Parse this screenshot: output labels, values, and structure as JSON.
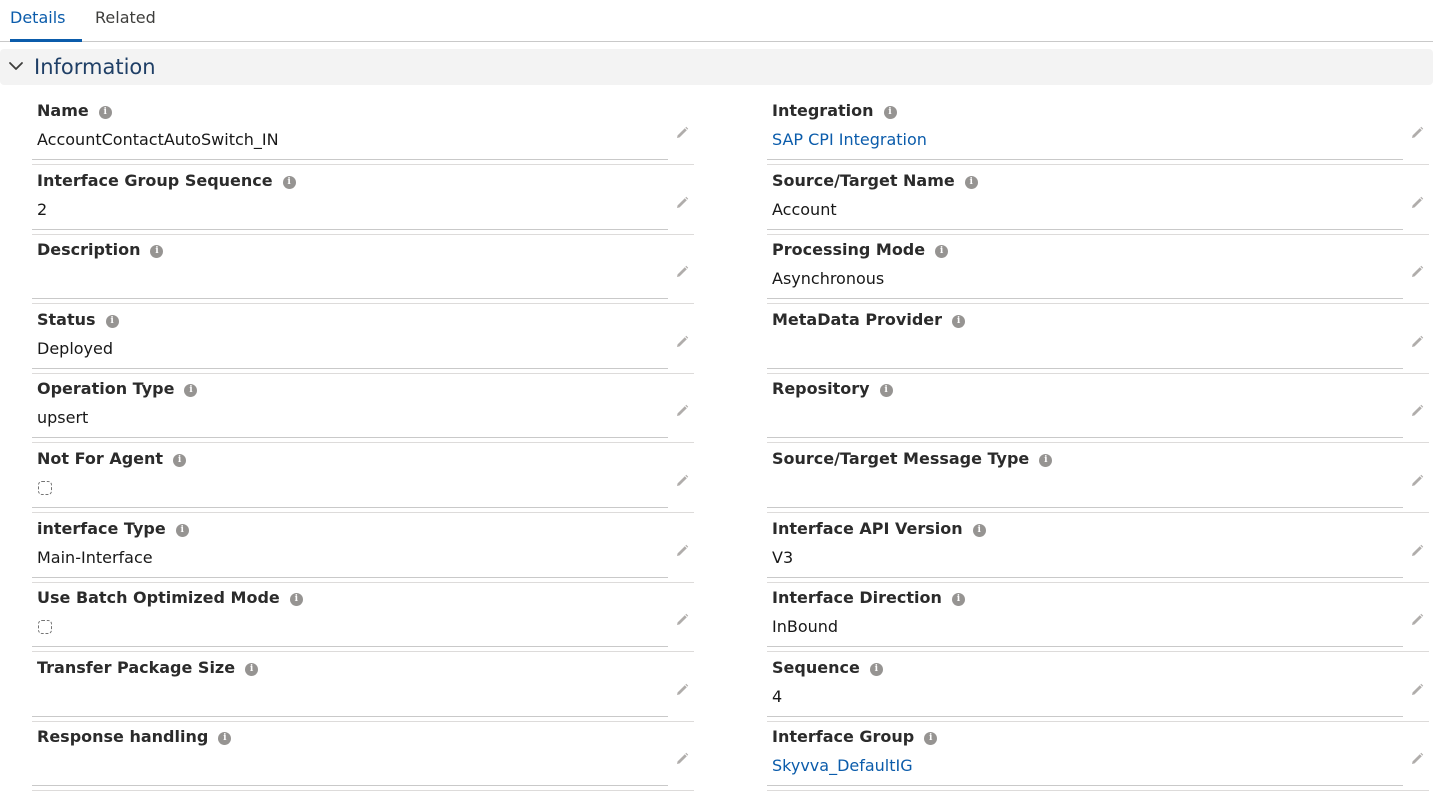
{
  "tabs": [
    {
      "label": "Details",
      "active": true
    },
    {
      "label": "Related",
      "active": false
    }
  ],
  "section": {
    "title": "Information",
    "expanded": true
  },
  "left_fields": [
    {
      "label": "Name",
      "value": "AccountContactAutoSwitch_IN",
      "type": "text"
    },
    {
      "label": "Interface Group Sequence",
      "value": "2",
      "type": "text"
    },
    {
      "label": "Description",
      "value": "",
      "type": "text"
    },
    {
      "label": "Status",
      "value": "Deployed",
      "type": "text"
    },
    {
      "label": "Operation Type",
      "value": "upsert",
      "type": "text"
    },
    {
      "label": "Not For Agent",
      "value": "",
      "type": "checkbox",
      "checked": false
    },
    {
      "label": "interface Type",
      "value": "Main-Interface",
      "type": "text"
    },
    {
      "label": "Use Batch Optimized Mode",
      "value": "",
      "type": "checkbox",
      "checked": false
    },
    {
      "label": "Transfer Package Size",
      "value": "",
      "type": "text"
    },
    {
      "label": "Response handling",
      "value": "",
      "type": "text"
    }
  ],
  "right_fields": [
    {
      "label": "Integration",
      "value": "SAP CPI Integration",
      "type": "link"
    },
    {
      "label": "Source/Target Name",
      "value": "Account",
      "type": "text"
    },
    {
      "label": "Processing Mode",
      "value": "Asynchronous",
      "type": "text"
    },
    {
      "label": "MetaData Provider",
      "value": "",
      "type": "text"
    },
    {
      "label": "Repository",
      "value": "",
      "type": "text"
    },
    {
      "label": "Source/Target Message Type",
      "value": "",
      "type": "text"
    },
    {
      "label": "Interface API Version",
      "value": "V3",
      "type": "text"
    },
    {
      "label": "Interface Direction",
      "value": "InBound",
      "type": "text"
    },
    {
      "label": "Sequence",
      "value": "4",
      "type": "text"
    },
    {
      "label": "Interface Group",
      "value": "Skyvva_DefaultIG",
      "type": "link"
    }
  ],
  "icons": {
    "info": "info-icon",
    "edit": "pencil-edit-icon",
    "section_toggle": "chevron-down-icon"
  },
  "colors": {
    "accent": "#0b5cab",
    "section_title": "#1f3f66",
    "section_bg": "#f3f3f3"
  }
}
